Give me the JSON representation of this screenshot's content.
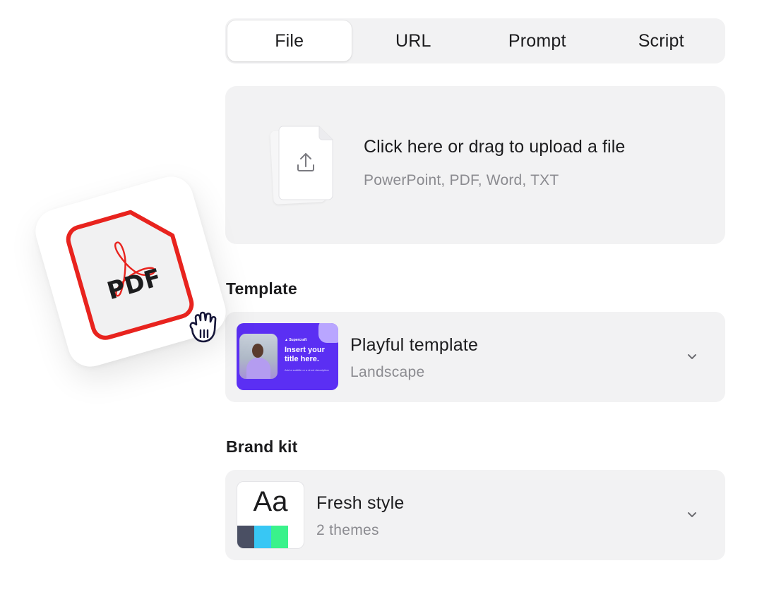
{
  "tabs": [
    {
      "label": "File",
      "active": true
    },
    {
      "label": "URL",
      "active": false
    },
    {
      "label": "Prompt",
      "active": false
    },
    {
      "label": "Script",
      "active": false
    }
  ],
  "upload": {
    "title": "Click here or drag to upload a file",
    "formats": "PowerPoint, PDF, Word, TXT",
    "icon": "upload-arrow-icon"
  },
  "template": {
    "section_label": "Template",
    "name": "Playful template",
    "orientation": "Landscape",
    "thumbnail": {
      "logo": "▲ Supercraft",
      "title": "Insert your title here.",
      "caption": "Add a subtitle or a short description"
    },
    "accent": "#5b2ff3"
  },
  "brand_kit": {
    "section_label": "Brand kit",
    "name": "Fresh style",
    "themes": "2 themes",
    "sample_text": "Aa",
    "swatches": [
      "#4a4f63",
      "#38c7f4",
      "#3af28b"
    ]
  },
  "floating_file": {
    "label": "PDF",
    "accent": "#e8231e",
    "icon": "acrobat-icon"
  },
  "cursor": {
    "icon": "grab-hand-icon"
  }
}
